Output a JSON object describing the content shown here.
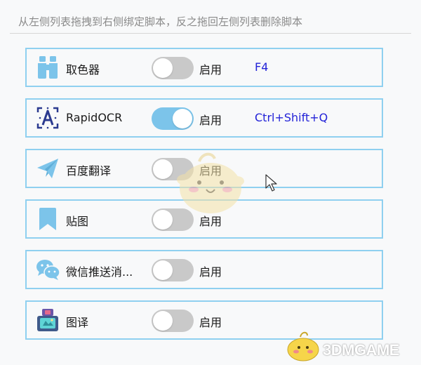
{
  "hint": "从左侧列表拖拽到右侧绑定脚本，反之拖回左侧列表删除脚本",
  "rows": [
    {
      "icon": "binoculars-icon",
      "name": "取色器",
      "enabled": false,
      "toggle_label": "启用",
      "hotkey": "F4"
    },
    {
      "icon": "ocr-scan-icon",
      "name": "RapidOCR",
      "enabled": true,
      "toggle_label": "启用",
      "hotkey": "Ctrl+Shift+Q"
    },
    {
      "icon": "paper-plane-icon",
      "name": "百度翻译",
      "enabled": false,
      "toggle_label": "启用",
      "hotkey": ""
    },
    {
      "icon": "bookmark-icon",
      "name": "贴图",
      "enabled": false,
      "toggle_label": "启用",
      "hotkey": ""
    },
    {
      "icon": "wechat-icon",
      "name": "微信推送消...",
      "enabled": false,
      "toggle_label": "启用",
      "hotkey": ""
    },
    {
      "icon": "translate-app-icon",
      "name": "图译",
      "enabled": false,
      "toggle_label": "启用",
      "hotkey": ""
    }
  ],
  "watermark": "3DMGAME",
  "colors": {
    "row_border": "#8fd0f0",
    "toggle_on": "#7cc4ea",
    "toggle_off": "#c9c9c9",
    "hotkey": "#2323d8"
  }
}
